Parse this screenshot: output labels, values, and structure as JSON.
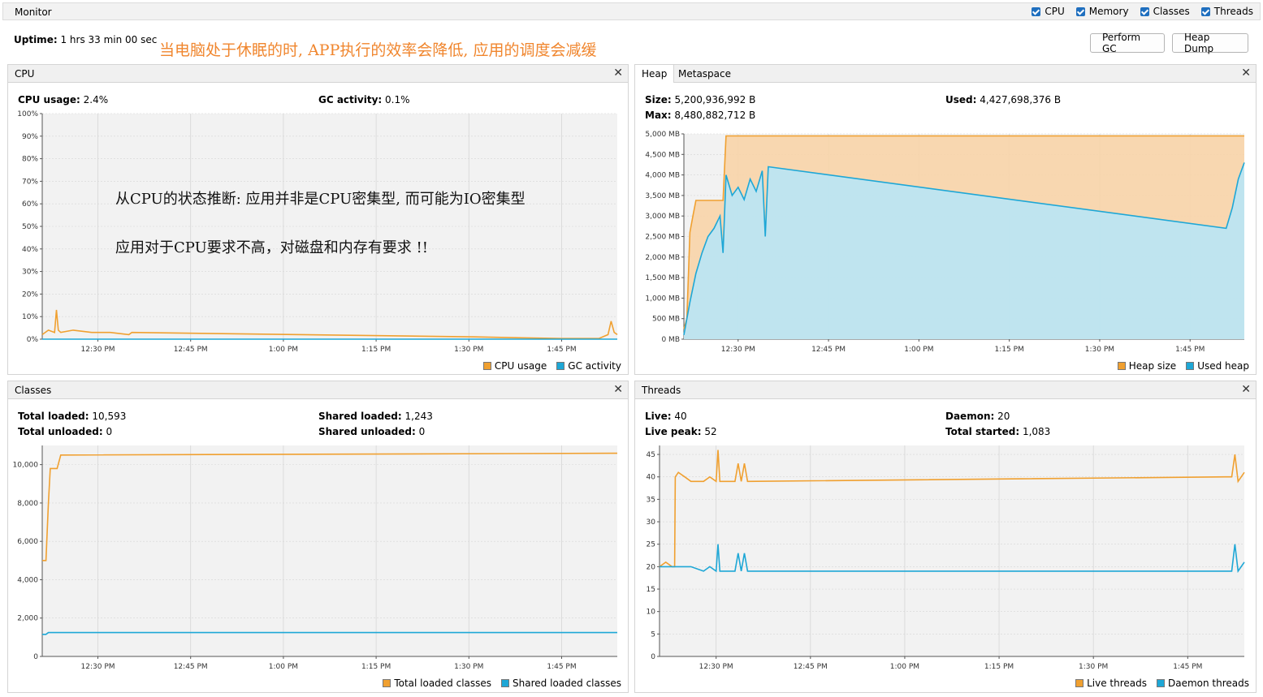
{
  "monitor": {
    "title": "Monitor",
    "checkboxes": [
      {
        "label": "CPU",
        "checked": true
      },
      {
        "label": "Memory",
        "checked": true
      },
      {
        "label": "Classes",
        "checked": true
      },
      {
        "label": "Threads",
        "checked": true
      }
    ],
    "uptime_label": "Uptime:",
    "uptime_value": "1 hrs 33 min 00 sec",
    "banner": "当电脑处于休眠的时, APP执行的效率会降低, 应用的调度会减缓",
    "perform_gc": "Perform GC",
    "heap_dump": "Heap Dump"
  },
  "colors": {
    "orange": "#f0a030",
    "blue": "#1ea7d6",
    "orange_fill": "#f8d4a8",
    "blue_fill": "#b8e6f6",
    "plot_bg": "#f2f2f2",
    "grid": "#d6d6d6"
  },
  "cpu": {
    "title": "CPU",
    "usage_label": "CPU usage:",
    "usage_value": "2.4%",
    "gc_label": "GC activity:",
    "gc_value": "0.1%",
    "note1": "从CPU的状态推断: 应用并非是CPU密集型, 而可能为IO密集型",
    "note2": "应用对于CPU要求不高，对磁盘和内存有要求 !!",
    "legend": [
      "CPU usage",
      "GC activity"
    ]
  },
  "heap": {
    "tab_heap": "Heap",
    "tab_metaspace": "Metaspace",
    "size_label": "Size:",
    "size_value": "5,200,936,992 B",
    "used_label": "Used:",
    "used_value": "4,427,698,376 B",
    "max_label": "Max:",
    "max_value": "8,480,882,712 B",
    "legend": [
      "Heap size",
      "Used heap"
    ]
  },
  "classes": {
    "title": "Classes",
    "total_loaded_label": "Total loaded:",
    "total_loaded_value": "10,593",
    "total_unloaded_label": "Total unloaded:",
    "total_unloaded_value": "0",
    "shared_loaded_label": "Shared loaded:",
    "shared_loaded_value": "1,243",
    "shared_unloaded_label": "Shared unloaded:",
    "shared_unloaded_value": "0",
    "legend": [
      "Total loaded classes",
      "Shared loaded classes"
    ]
  },
  "threads": {
    "title": "Threads",
    "live_label": "Live:",
    "live_value": "40",
    "daemon_label": "Daemon:",
    "daemon_value": "20",
    "peak_label": "Live peak:",
    "peak_value": "52",
    "started_label": "Total started:",
    "started_value": "1,083",
    "legend": [
      "Live threads",
      "Daemon threads"
    ]
  },
  "chart_data": [
    {
      "id": "cpu",
      "type": "line",
      "x_ticks": [
        "12:30 PM",
        "12:45 PM",
        "1:00 PM",
        "1:15 PM",
        "1:30 PM",
        "1:45 PM"
      ],
      "x_range_min": [
        0,
        93
      ],
      "x_tick_positions_min": [
        9,
        24,
        39,
        54,
        69,
        84
      ],
      "y_ticks": [
        "0%",
        "10%",
        "20%",
        "30%",
        "40%",
        "50%",
        "60%",
        "70%",
        "80%",
        "90%",
        "100%"
      ],
      "ylim": [
        0,
        100
      ],
      "series": [
        {
          "name": "CPU usage",
          "x": [
            0,
            1,
            2,
            2.3,
            2.6,
            3,
            5,
            8,
            11,
            14,
            14.5,
            70,
            84,
            90,
            91.5,
            92,
            92.5,
            93
          ],
          "y": [
            2,
            4,
            3,
            13,
            4,
            3,
            4,
            3,
            3,
            2,
            3,
            1,
            0.3,
            0.3,
            2,
            8,
            3,
            2
          ]
        },
        {
          "name": "GC activity",
          "x": [
            0,
            93
          ],
          "y": [
            0,
            0
          ]
        }
      ]
    },
    {
      "id": "heap",
      "type": "area",
      "x_ticks": [
        "12:30 PM",
        "12:45 PM",
        "1:00 PM",
        "1:15 PM",
        "1:30 PM",
        "1:45 PM"
      ],
      "x_range_min": [
        0,
        93
      ],
      "x_tick_positions_min": [
        9,
        24,
        39,
        54,
        69,
        84
      ],
      "y_ticks": [
        "0 MB",
        "500 MB",
        "1,000 MB",
        "1,500 MB",
        "2,000 MB",
        "2,500 MB",
        "3,000 MB",
        "3,500 MB",
        "4,000 MB",
        "4,500 MB",
        "5,000 MB"
      ],
      "ylim": [
        0,
        5000
      ],
      "series": [
        {
          "name": "Heap size",
          "x": [
            0,
            0.5,
            1,
            1.5,
            2,
            6.5,
            7,
            93
          ],
          "y": [
            250,
            500,
            2600,
            3000,
            3380,
            3380,
            4950,
            4950
          ]
        },
        {
          "name": "Used heap",
          "x": [
            0,
            1,
            2,
            3,
            4,
            5,
            6,
            6.5,
            7,
            8,
            9,
            10,
            11,
            12,
            13,
            13.5,
            14,
            90,
            91,
            92,
            93
          ],
          "y": [
            100,
            900,
            1600,
            2100,
            2500,
            2700,
            3000,
            2100,
            4000,
            3500,
            3700,
            3400,
            3900,
            3600,
            4100,
            2500,
            4200,
            2700,
            3200,
            3900,
            4300
          ]
        }
      ]
    },
    {
      "id": "classes",
      "type": "line",
      "x_ticks": [
        "12:30 PM",
        "12:45 PM",
        "1:00 PM",
        "1:15 PM",
        "1:30 PM",
        "1:45 PM"
      ],
      "x_range_min": [
        0,
        93
      ],
      "x_tick_positions_min": [
        9,
        24,
        39,
        54,
        69,
        84
      ],
      "y_ticks": [
        "0",
        "2,000",
        "4,000",
        "6,000",
        "8,000",
        "10,000"
      ],
      "ylim": [
        0,
        11000
      ],
      "series": [
        {
          "name": "Total loaded classes",
          "x": [
            0,
            0.6,
            1,
            1.3,
            2.4,
            3,
            93
          ],
          "y": [
            5000,
            5000,
            8000,
            9800,
            9800,
            10500,
            10593
          ]
        },
        {
          "name": "Shared loaded classes",
          "x": [
            0,
            0.6,
            1,
            93
          ],
          "y": [
            1150,
            1150,
            1243,
            1243
          ]
        }
      ]
    },
    {
      "id": "threads",
      "type": "line",
      "x_ticks": [
        "12:30 PM",
        "12:45 PM",
        "1:00 PM",
        "1:15 PM",
        "1:30 PM",
        "1:45 PM"
      ],
      "x_range_min": [
        0,
        93
      ],
      "x_tick_positions_min": [
        9,
        24,
        39,
        54,
        69,
        84
      ],
      "y_ticks": [
        "0",
        "5",
        "10",
        "15",
        "20",
        "25",
        "30",
        "35",
        "40",
        "45"
      ],
      "ylim": [
        0,
        47
      ],
      "series": [
        {
          "name": "Live threads",
          "x": [
            0,
            1,
            2,
            2.4,
            2.5,
            3,
            4,
            5,
            7,
            8,
            9,
            9.3,
            9.6,
            10,
            12,
            12.5,
            13,
            13.5,
            14,
            90,
            91,
            91.5,
            92,
            93
          ],
          "y": [
            20,
            21,
            20,
            20,
            40,
            41,
            40,
            39,
            39,
            40,
            39,
            46,
            39,
            39,
            39,
            43,
            39,
            43,
            39,
            40,
            40,
            45,
            39,
            41
          ]
        },
        {
          "name": "Daemon threads",
          "x": [
            0,
            1,
            2,
            5,
            7,
            8,
            9,
            9.3,
            9.6,
            10,
            12,
            12.5,
            13,
            13.5,
            14,
            90,
            91,
            91.5,
            92,
            93
          ],
          "y": [
            20,
            20,
            20,
            20,
            19,
            20,
            19,
            25,
            19,
            19,
            19,
            23,
            19,
            23,
            19,
            19,
            19,
            25,
            19,
            21
          ]
        }
      ]
    }
  ]
}
